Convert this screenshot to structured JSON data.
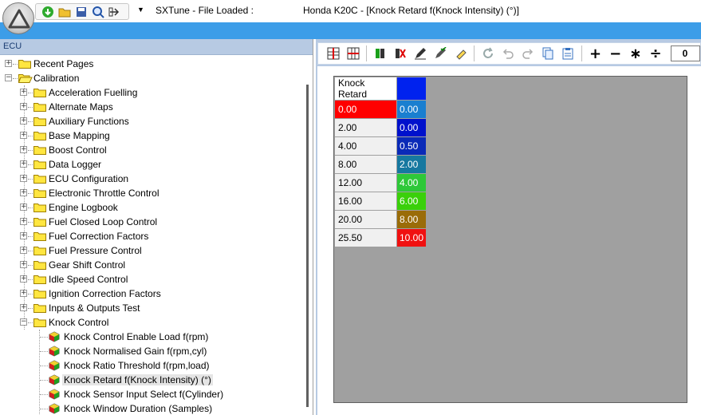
{
  "titlebar": {
    "app": "SXTune - File Loaded :",
    "document": "Honda K20C - [Knock Retard f(Knock Intensity) (°)]",
    "qa_dropdown": "▼"
  },
  "left_pane": {
    "header": "ECU",
    "tree": [
      {
        "label": "Recent Pages",
        "level": 0,
        "expander": "+",
        "icon": "folder-icon"
      },
      {
        "label": "Calibration",
        "level": 0,
        "expander": "−",
        "icon": "open-folder-icon"
      },
      {
        "label": "Acceleration Fuelling",
        "level": 1,
        "expander": "+",
        "icon": "folder-icon"
      },
      {
        "label": "Alternate Maps",
        "level": 1,
        "expander": "+",
        "icon": "folder-icon"
      },
      {
        "label": "Auxiliary Functions",
        "level": 1,
        "expander": "+",
        "icon": "folder-icon"
      },
      {
        "label": "Base Mapping",
        "level": 1,
        "expander": "+",
        "icon": "folder-icon"
      },
      {
        "label": "Boost Control",
        "level": 1,
        "expander": "+",
        "icon": "folder-icon"
      },
      {
        "label": "Data Logger",
        "level": 1,
        "expander": "+",
        "icon": "folder-icon"
      },
      {
        "label": "ECU Configuration",
        "level": 1,
        "expander": "+",
        "icon": "folder-icon"
      },
      {
        "label": "Electronic Throttle Control",
        "level": 1,
        "expander": "+",
        "icon": "folder-icon"
      },
      {
        "label": "Engine Logbook",
        "level": 1,
        "expander": "+",
        "icon": "folder-icon"
      },
      {
        "label": "Fuel Closed Loop Control",
        "level": 1,
        "expander": "+",
        "icon": "folder-icon"
      },
      {
        "label": "Fuel Correction Factors",
        "level": 1,
        "expander": "+",
        "icon": "folder-icon"
      },
      {
        "label": "Fuel Pressure Control",
        "level": 1,
        "expander": "+",
        "icon": "folder-icon"
      },
      {
        "label": "Gear Shift Control",
        "level": 1,
        "expander": "+",
        "icon": "folder-icon"
      },
      {
        "label": "Idle Speed Control",
        "level": 1,
        "expander": "+",
        "icon": "folder-icon"
      },
      {
        "label": "Ignition Correction Factors",
        "level": 1,
        "expander": "+",
        "icon": "folder-icon"
      },
      {
        "label": "Inputs & Outputs Test",
        "level": 1,
        "expander": "+",
        "icon": "folder-icon"
      },
      {
        "label": "Knock Control",
        "level": 1,
        "expander": "−",
        "icon": "folder-icon"
      },
      {
        "label": "Knock Control Enable Load f(rpm)",
        "level": 2,
        "expander": "",
        "icon": "map-cube-icon"
      },
      {
        "label": "Knock Normalised Gain f(rpm,cyl)",
        "level": 2,
        "expander": "",
        "icon": "map-cube-icon"
      },
      {
        "label": "Knock Ratio Threshold f(rpm,load)",
        "level": 2,
        "expander": "",
        "icon": "map-cube-icon"
      },
      {
        "label": "Knock Retard f(Knock Intensity) (°)",
        "level": 2,
        "expander": "",
        "icon": "map-cube-icon",
        "selected": true
      },
      {
        "label": "Knock Sensor Input Select f(Cylinder)",
        "level": 2,
        "expander": "",
        "icon": "map-cube-icon"
      },
      {
        "label": "Knock Window Duration (Samples)",
        "level": 2,
        "expander": "",
        "icon": "map-cube-icon"
      }
    ]
  },
  "toolbar": {
    "value": "0",
    "ops": [
      "+",
      "−",
      "∗",
      "÷"
    ]
  },
  "table": {
    "header": "Knock Retard",
    "header_color": "#0022ee",
    "rows": [
      {
        "key": "0.00",
        "value": "0.00",
        "color": "#1a7fd0",
        "selected": true
      },
      {
        "key": "2.00",
        "value": "0.00",
        "color": "#0011cc"
      },
      {
        "key": "4.00",
        "value": "0.50",
        "color": "#0a2ab8"
      },
      {
        "key": "8.00",
        "value": "2.00",
        "color": "#1678a0"
      },
      {
        "key": "12.00",
        "value": "4.00",
        "color": "#2ec838"
      },
      {
        "key": "16.00",
        "value": "6.00",
        "color": "#3ad00a"
      },
      {
        "key": "20.00",
        "value": "8.00",
        "color": "#9a6c08"
      },
      {
        "key": "25.50",
        "value": "10.00",
        "color": "#f01010"
      }
    ]
  }
}
